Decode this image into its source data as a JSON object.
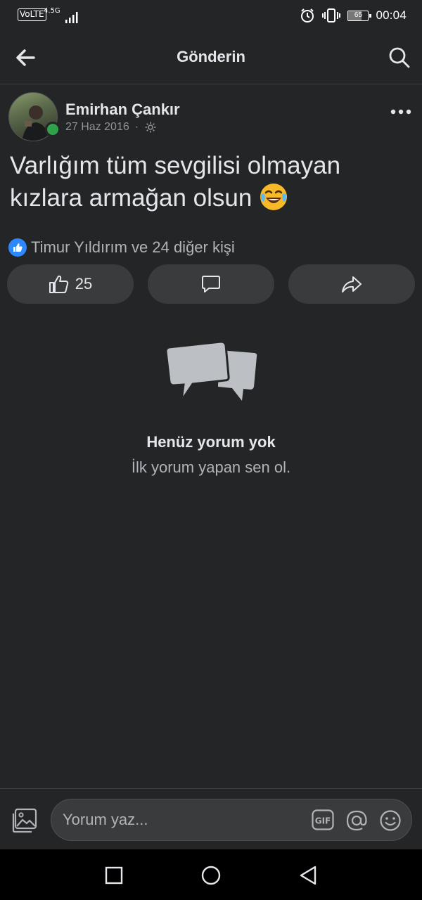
{
  "status_bar": {
    "volte": "VoLTE",
    "network": "4.5G",
    "battery": "65",
    "battery_level": 0.65,
    "time": "00:04"
  },
  "header": {
    "title": "Gönderin",
    "back_icon": "arrow-left-icon",
    "search_icon": "search-icon"
  },
  "post": {
    "author": "Emirhan Çankır",
    "date": "27 Haz 2016",
    "separator": "·",
    "privacy_icon": "gear-icon",
    "text": "Varlığım tüm sevgilisi olmayan kızlara armağan olsun",
    "emoji_icon": "face-with-tears-of-joy-icon",
    "reactions_text": "Timur Yıldırım ve 24 diğer kişi",
    "like_count": "25"
  },
  "empty_state": {
    "title": "Henüz yorum yok",
    "subtitle": "İlk yorum yapan sen ol."
  },
  "composer": {
    "placeholder": "Yorum yaz...",
    "gif_label": "GIF"
  },
  "colors": {
    "background": "#242526",
    "surface": "#3a3b3c",
    "accent": "#2d88ff",
    "online": "#31a24c"
  }
}
